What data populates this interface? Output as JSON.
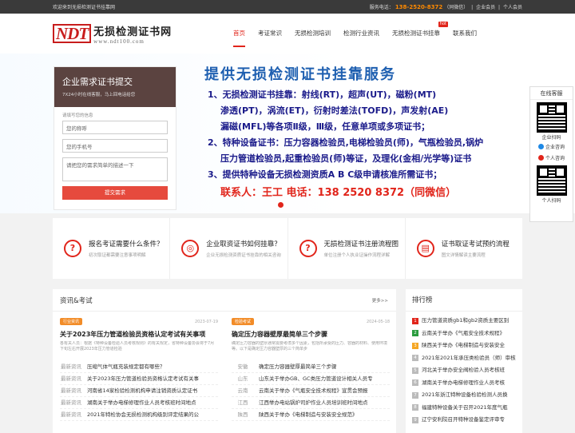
{
  "topbar": {
    "welcome": "欢迎来到无损检测证书挂靠网",
    "phone_label": "服务电话：",
    "phone": "138-2520-8372",
    "phone_note": "（同微信）",
    "sep": "|",
    "login": "企业会员",
    "personal": "个人会员"
  },
  "logo": {
    "mark": "NDT",
    "name": "无损检测证书网",
    "url": "www.ndt100.com"
  },
  "nav": [
    {
      "label": "首页"
    },
    {
      "label": "考证常识"
    },
    {
      "label": "无损检测培训"
    },
    {
      "label": "检测行业资讯"
    },
    {
      "label": "无损检测证书挂靠",
      "badge": "hot"
    },
    {
      "label": "联系我们"
    }
  ],
  "banner": {
    "headline": "提供无损检测证书挂靠服务",
    "line1": "1、无损检测证书挂靠：射线(RT)，超声(UT)，磁粉(MT)",
    "line2": "渗透(PT)，涡流(ET)，衍射时差法(TOFD)，声发射(AE)",
    "line3": "漏磁(MFL)等各项Ⅱ级，Ⅲ级，任意单项或多项证书；",
    "line4": "2、特种设备证书：压力容器检验员,电梯检验员(师)，气瓶检验员,锅炉",
    "line5": "压力管道检验员,起重检验员(师)等证，及理化(金相/光学等)证书",
    "line6": "3、提供特种设备无损检测资质A B C级申请核准所需证书；",
    "contact": "联系人：王工   电话：138 2520 8372（同微信）"
  },
  "form": {
    "title": "企业需求证书提交",
    "subtitle": "7X24小时在线客服，马上回电话给您",
    "label": "请填写您的信息",
    "name_placeholder": "您的称呼",
    "phone_placeholder": "您的手机号",
    "desc_placeholder": "请把您的需求简单的描述一下",
    "submit": "提交需求"
  },
  "side": {
    "title": "在线客服",
    "scan1": "企业扫码",
    "corp": "企业咨询",
    "personal": "个人咨询",
    "scan2": "个人扫码"
  },
  "services": [
    {
      "icon": "?",
      "title": "报名考证需要什么条件？",
      "sub": "初次取证都需要注意事项明解"
    },
    {
      "icon": "◎",
      "title": "企业取资证书如何挂靠？",
      "sub": "企业无损检测资质证书挂靠的相关咨询"
    },
    {
      "icon": "?",
      "title": "无损检测证书注册流程图",
      "sub": "单位注册个人执业证操作流程详解"
    },
    {
      "icon": "▤",
      "title": "证书取证考试预约流程",
      "sub": "图文详情解读主要流程"
    }
  ],
  "news": {
    "title": "资讯&考试",
    "more": "更多>>",
    "left": {
      "tag": "行业资讯",
      "date": "2023-07-19",
      "headline": "关于2023年压力管道检验员资格认定考试有关事项",
      "desc": "各有关人员：根据《特种设备检验人员考核规则》的有关规定，省特种设备协会将于7月下旬左右开展2023年压力管道检验",
      "items": [
        {
          "cat": "最新资讯",
          "text": "压缩气体气瓶充装规定都有哪些？"
        },
        {
          "cat": "最新资讯",
          "text": "关于2023年压力管道检验员资格认定考试有关事"
        },
        {
          "cat": "最新资讯",
          "text": "河南省14家检验检测机构申请注销资质认定证书"
        },
        {
          "cat": "最新资讯",
          "text": "湖南关于举办电梯修理作业人员考核班时间地点"
        },
        {
          "cat": "最新资讯",
          "text": "2021年特检协会无损检测机构级别评定结果的公"
        }
      ]
    },
    "right": {
      "tag": "检验考试",
      "date": "2024-05-18",
      "headline": "确定压力容器壁厚最简单三个步骤",
      "desc": "确定压力容器的壁厚通常需要考虑多个因素，包括所承受的压力、容器的材料、使用环境等。以下是确定压力容器壁厚的三个简单步",
      "items": [
        {
          "cat": "安徽",
          "text": "确定压力容器壁厚最简单三个步骤"
        },
        {
          "cat": "山东",
          "text": "山东关于举办GB、GC类压力管道设计相关人员专"
        },
        {
          "cat": "云南",
          "text": "云南关于举办《气瓶安全技术规程》宣贯会预报"
        },
        {
          "cat": "江西",
          "text": "江西举办电站锅炉司炉作业人员培训班时间地点"
        },
        {
          "cat": "陕西",
          "text": "陕西关于举办《电梯制造与安装安全规范》"
        }
      ]
    }
  },
  "rank": {
    "title": "排行榜",
    "items": [
      "压力管道资质gb1和gb2资质主要区别",
      "云南关于举办《气瓶安全技术规程》",
      "陕西关于举办《电梯制造与安装安全",
      "2021年2021年承压类检验员（师）审核",
      "河北关于举办安全阀检验人员考核班",
      "湖南关于举办电梯修理作业人员考核",
      "2021年浙江特种设备检验检测人员换",
      "福建特种设备关于召开2021年度气瓶",
      "辽宁安利院召开特种设备鉴定评审专"
    ]
  }
}
